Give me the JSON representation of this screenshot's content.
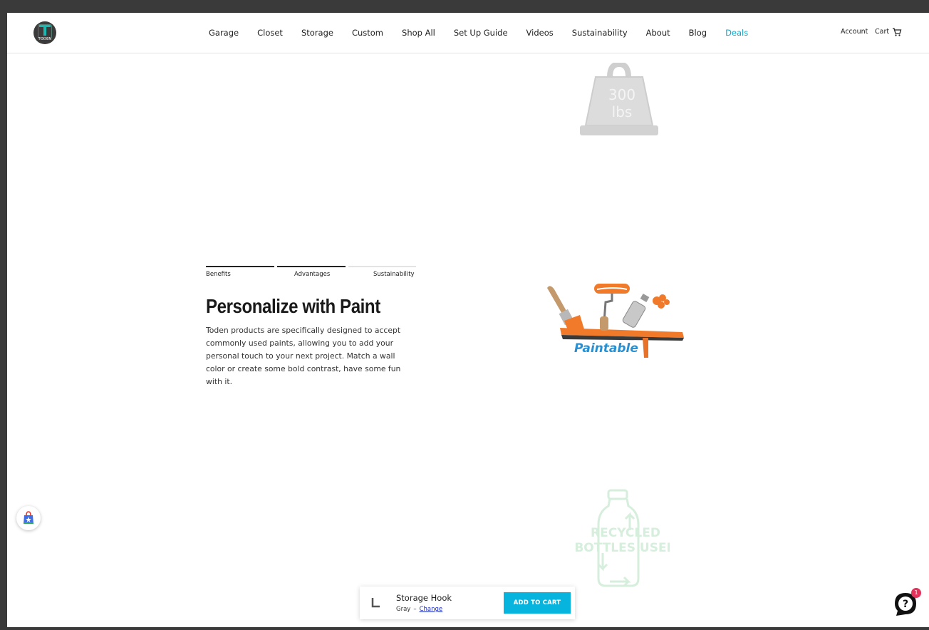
{
  "header": {
    "logo_text": "TODEN",
    "nav": [
      "Garage",
      "Closet",
      "Storage",
      "Custom",
      "Shop All",
      "Set Up Guide",
      "Videos",
      "Sustainability",
      "About",
      "Blog",
      "Deals"
    ],
    "account_label": "Account",
    "cart_label": "Cart",
    "deals_color": "#14a6c8"
  },
  "images": {
    "weight_text_1": "300",
    "weight_text_2": "lbs",
    "paint_text": "Paintable",
    "recycle_text_1": "RECYCLED",
    "recycle_text_2": "BOTTLES USED"
  },
  "tabs": {
    "items": [
      "Benefits",
      "Advantages",
      "Sustainability"
    ]
  },
  "content": {
    "title": "Personalize with Paint",
    "description": "Toden products are specifically designed to accept commonly used paints, allowing you to add your personal touch to your next project. Match a wall color or create some bold contrast, have some fun with it."
  },
  "sticky_cart": {
    "product_name": "Storage Hook",
    "variant": "Gray",
    "separator": "–",
    "change_label": "Change",
    "button_label": "ADD TO CART",
    "button_color": "#06b4de"
  },
  "chat": {
    "badge_count": "1",
    "icon": "help-icon"
  }
}
